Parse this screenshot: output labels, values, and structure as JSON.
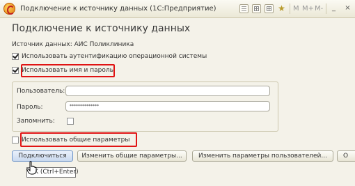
{
  "window": {
    "title": "Подключение к источнику данных  (1С:Предприятие)",
    "toolbar": {
      "m": "M",
      "m_plus": "M+",
      "m_minus": "M-"
    },
    "controls": {
      "minimize": "_",
      "maximize": "□",
      "close": "×"
    }
  },
  "form": {
    "heading": "Подключение к источнику данных",
    "source_label": "Источник данных: АИС Поликлиника",
    "use_os_auth": {
      "label": "Использовать аутентификацию операционной системы",
      "checked": true
    },
    "use_login_password": {
      "label": "Использовать имя и пароль",
      "checked": true
    },
    "user": {
      "label": "Пользователь:",
      "value": ""
    },
    "password": {
      "label": "Пароль:",
      "value": "**************"
    },
    "remember": {
      "label": "Запомнить:",
      "checked": false
    },
    "use_common_params": {
      "label": "Использовать общие параметры",
      "checked": false
    }
  },
  "buttons": {
    "connect": "Подключиться",
    "change_common": "Изменить общие параметры...",
    "change_user_params": "Изменить параметры пользователей...",
    "cut": "О"
  },
  "tooltip": "OK (Ctrl+Enter)",
  "colors": {
    "highlight": "#e01414",
    "primary_button": "#c9d9ef"
  }
}
